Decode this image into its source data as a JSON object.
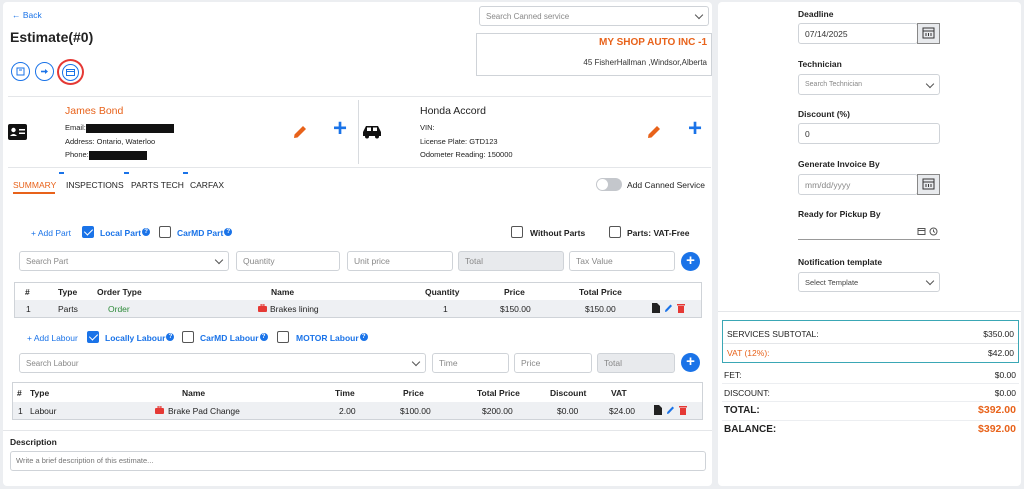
{
  "header": {
    "back": "Back",
    "title": "Estimate(#0)",
    "canned_placeholder": "Search Canned service"
  },
  "shop": {
    "name": "MY SHOP AUTO INC -1",
    "address": "45 FisherHallman ,Windsor,Alberta"
  },
  "customer": {
    "name": "James Bond",
    "email_label": "Email:",
    "address": "Address: Ontario, Waterloo",
    "phone_label": "Phone:"
  },
  "vehicle": {
    "name": "Honda Accord",
    "vin": "VIN:",
    "plate": "License Plate: GTD123",
    "odometer": "Odometer Reading: 150000"
  },
  "tabs": [
    "SUMMARY",
    "INSPECTIONS",
    "PARTS TECH",
    "CARFAX"
  ],
  "canned_toggle": "Add Canned Service",
  "parts": {
    "add": "+ Add Part",
    "local": "Local Part",
    "carmd": "CarMD Part",
    "without": "Without Parts",
    "vatfree": "Parts: VAT-Free",
    "search_placeholder": "Search Part",
    "qty_placeholder": "Quantity",
    "unit_placeholder": "Unit price",
    "total_placeholder": "Total",
    "tax_placeholder": "Tax Value",
    "headers": [
      "#",
      "Type",
      "Order Type",
      "Name",
      "Quantity",
      "Price",
      "Total Price"
    ],
    "rows": [
      {
        "num": "1",
        "type": "Parts",
        "order": "Order",
        "name": "Brakes lining",
        "qty": "1",
        "price": "$150.00",
        "total": "$150.00"
      }
    ]
  },
  "labour": {
    "add": "+ Add Labour",
    "local": "Locally Labour",
    "carmd": "CarMD Labour",
    "motor": "MOTOR Labour",
    "search_placeholder": "Search Labour",
    "time_placeholder": "Time",
    "price_placeholder": "Price",
    "total_placeholder": "Total",
    "headers": [
      "#",
      "Type",
      "Name",
      "Time",
      "Price",
      "Total Price",
      "Discount",
      "VAT"
    ],
    "rows": [
      {
        "num": "1",
        "type": "Labour",
        "name": "Brake Pad Change",
        "time": "2.00",
        "price": "$100.00",
        "total": "$200.00",
        "discount": "$0.00",
        "vat": "$24.00"
      }
    ]
  },
  "description": {
    "label": "Description",
    "placeholder": "Write a brief description of this estimate..."
  },
  "right": {
    "deadline_label": "Deadline",
    "deadline_value": "07/14/2025",
    "technician_label": "Technician",
    "technician_placeholder": "Search Technician",
    "discount_label": "Discount (%)",
    "discount_value": "0",
    "invoice_label": "Generate Invoice By",
    "invoice_placeholder": "mm/dd/yyyy",
    "pickup_label": "Ready for Pickup By",
    "notif_label": "Notification template",
    "notif_placeholder": "Select Template"
  },
  "summary": {
    "services_label": "SERVICES SUBTOTAL:",
    "services_value": "$350.00",
    "vat_label": "VAT (12%):",
    "vat_value": "$42.00",
    "fet_label": "FET:",
    "fet_value": "$0.00",
    "discount_label": "DISCOUNT:",
    "discount_value": "$0.00",
    "total_label": "TOTAL:",
    "total_value": "$392.00",
    "balance_label": "BALANCE:",
    "balance_value": "$392.00"
  },
  "colors": {
    "accent": "#1a73e8",
    "orange": "#e8621a",
    "green": "#2e8b3a",
    "red": "#e53935"
  }
}
